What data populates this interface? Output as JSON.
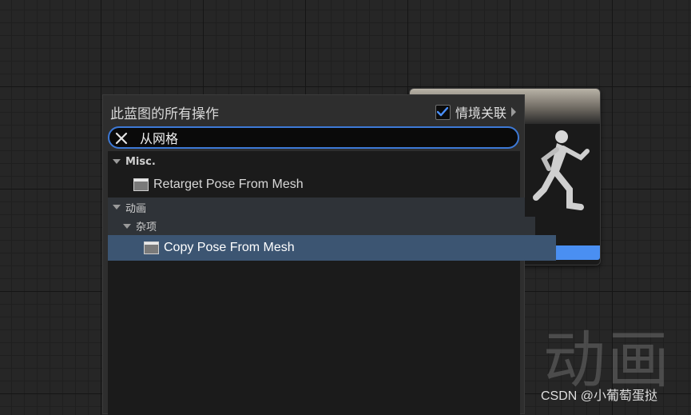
{
  "menu": {
    "title": "此蓝图的所有操作",
    "context_checkbox": {
      "label": "情境关联",
      "checked": true
    }
  },
  "search": {
    "value": "从网格"
  },
  "tree": [
    {
      "kind": "category",
      "label": "Misc."
    },
    {
      "kind": "item",
      "label": "Retarget Pose From Mesh"
    },
    {
      "kind": "category",
      "label": "动画"
    },
    {
      "kind": "category",
      "label": "杂项"
    },
    {
      "kind": "item",
      "label": "Copy Pose From Mesh",
      "selected": true
    }
  ],
  "background": {
    "watermark": "动画"
  },
  "credit": "CSDN @小葡萄蛋挞",
  "colors": {
    "accent": "#3d79d6",
    "selection": "#3c5572",
    "node_bar": "#4a8ff2"
  }
}
